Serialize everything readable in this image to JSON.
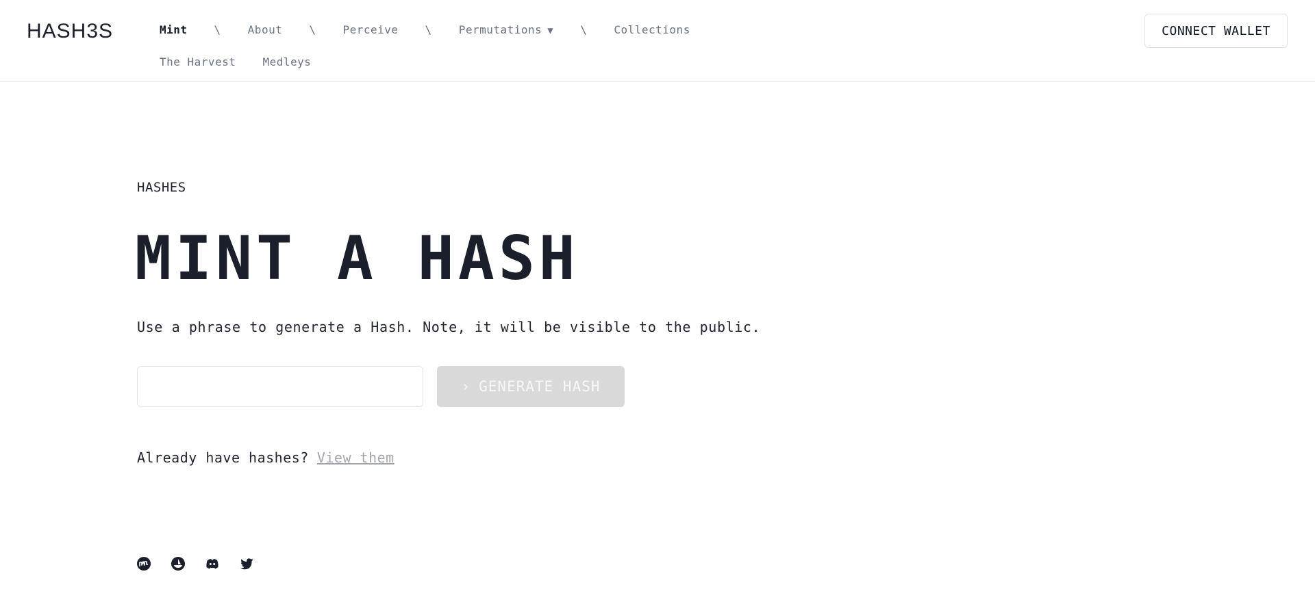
{
  "brand": {
    "logo_text": "HASH3S"
  },
  "nav": {
    "row1": [
      {
        "label": "Mint",
        "active": true
      },
      {
        "label": "About"
      },
      {
        "label": "Perceive"
      },
      {
        "label": "Permutations",
        "has_dropdown": true,
        "caret": "▼"
      },
      {
        "label": "Collections"
      }
    ],
    "separator": "\\",
    "row2": [
      {
        "label": "The Harvest"
      },
      {
        "label": "Medleys"
      }
    ]
  },
  "header": {
    "connect_label": "CONNECT WALLET"
  },
  "main": {
    "kicker": "HASHES",
    "title": "MINT A HASH",
    "description": "Use a phrase to generate a Hash. Note, it will be visible to the public.",
    "phrase_input": {
      "value": "",
      "placeholder": ""
    },
    "generate_button": {
      "chevron": "›",
      "label": "GENERATE HASH",
      "disabled": true
    },
    "already": {
      "text": "Already have hashes?",
      "link_label": "View them"
    }
  },
  "footer": {
    "socials": [
      "coinmarket-icon",
      "opensea-icon",
      "discord-icon",
      "twitter-icon"
    ]
  },
  "colors": {
    "text": "#1f2430",
    "nav_text": "#6b7384",
    "button_disabled_bg": "#d9d9d9",
    "link_muted": "#a1a6b0",
    "border": "#e6e8ec"
  }
}
